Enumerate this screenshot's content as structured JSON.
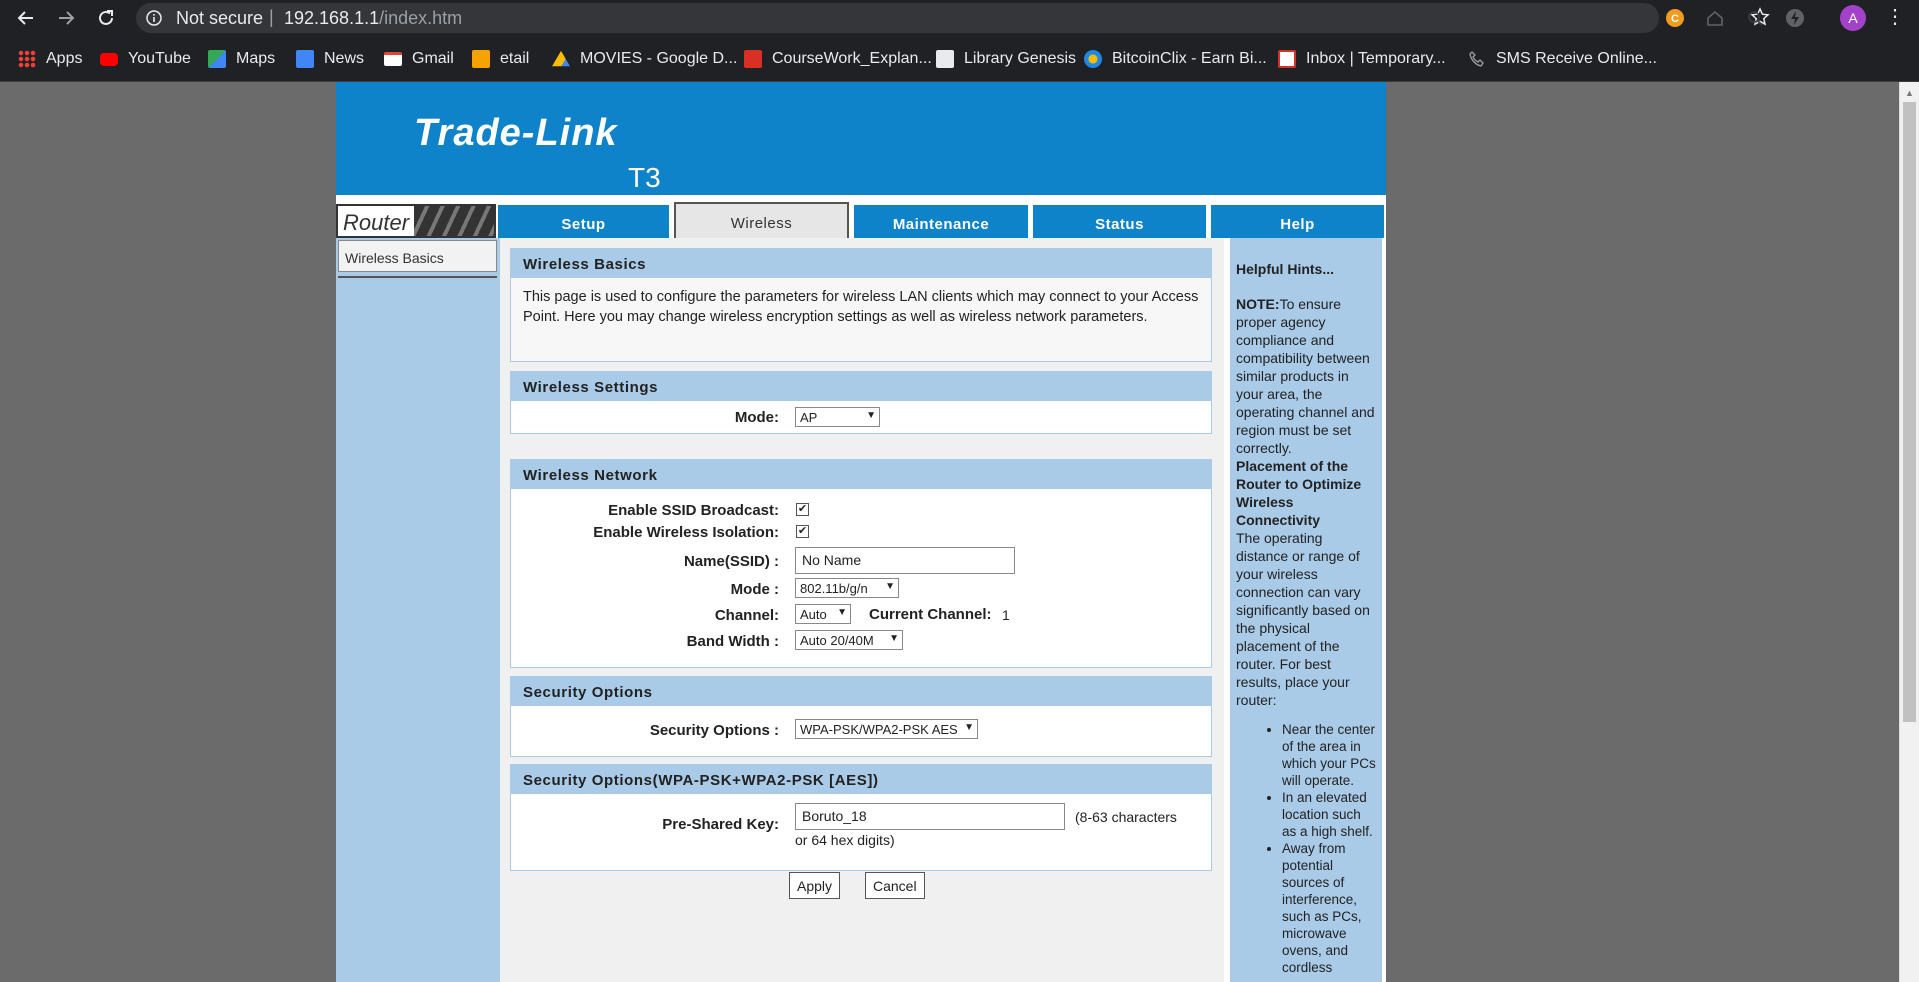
{
  "browser": {
    "security_label": "Not secure",
    "url_host": "192.168.1.1",
    "url_path": "/index.htm",
    "avatar_letter": "A"
  },
  "bookmarks": [
    {
      "label": "Apps",
      "icon": "apps-grid-icon",
      "color": "#4285f4"
    },
    {
      "label": "YouTube",
      "icon": "youtube-icon",
      "color": "#ff0000"
    },
    {
      "label": "Maps",
      "icon": "maps-icon",
      "color": "#34a853"
    },
    {
      "label": "News",
      "icon": "news-icon",
      "color": "#4285f4"
    },
    {
      "label": "Gmail",
      "icon": "gmail-icon",
      "color": "#ea4335"
    },
    {
      "label": "etail",
      "icon": "etail-icon",
      "color": "#f4a300"
    },
    {
      "label": "MOVIES - Google D...",
      "icon": "google-drive-icon",
      "color": "#fbbc04"
    },
    {
      "label": "CourseWork_Explan...",
      "icon": "coursework-icon",
      "color": "#d93025"
    },
    {
      "label": "Library Genesis",
      "icon": "library-icon",
      "color": "#e8eaed"
    },
    {
      "label": "BitcoinClix - Earn Bi...",
      "icon": "bitcoinclix-icon",
      "color": "#1e88e5"
    },
    {
      "label": "Inbox | Temporary...",
      "icon": "inbox-icon",
      "color": "#d93025"
    },
    {
      "label": "SMS Receive Online...",
      "icon": "phone-icon",
      "color": "#9aa0a6"
    }
  ],
  "router": {
    "brand": "Trade-Link",
    "model": "T3",
    "logo_text": "Router",
    "tabs": [
      "Setup",
      "Wireless",
      "Maintenance",
      "Status",
      "Help"
    ],
    "active_tab": "Wireless",
    "left_nav": [
      "Wireless Basics"
    ],
    "colors": {
      "brand_blue": "#0f83c9",
      "section_blue": "#a9cbe8"
    }
  },
  "basics": {
    "title": "Wireless Basics",
    "description": "This page is used to configure the parameters for wireless LAN clients which may connect to your Access Point. Here you may change wireless encryption settings as well as wireless network parameters."
  },
  "settings": {
    "title": "Wireless Settings",
    "mode_label": "Mode:",
    "mode_value": "AP"
  },
  "network": {
    "title": "Wireless Network",
    "ssid_broadcast_label": "Enable SSID Broadcast:",
    "ssid_broadcast_checked": true,
    "isolation_label": "Enable Wireless Isolation:",
    "isolation_checked": true,
    "name_label": "Name(SSID) :",
    "name_value": "No Name",
    "mode_label": "Mode :",
    "mode_value": "802.11b/g/n",
    "channel_label": "Channel:",
    "channel_value": "Auto",
    "current_channel_label": "Current Channel:",
    "current_channel_value": "1",
    "bandwidth_label": "Band Width :",
    "bandwidth_value": "Auto 20/40M"
  },
  "security": {
    "title": "Security Options",
    "label": "Security Options :",
    "value": "WPA-PSK/WPA2-PSK AES"
  },
  "wpa": {
    "title": "Security Options(WPA-PSK+WPA2-PSK [AES])",
    "psk_label": "Pre-Shared Key:",
    "psk_value": "Boruto_18",
    "psk_hint_1": "(8-63 characters",
    "psk_hint_2": "or 64 hex digits)"
  },
  "buttons": {
    "apply": "Apply",
    "cancel": "Cancel"
  },
  "hints": {
    "title": "Helpful Hints...",
    "note_label": "NOTE:",
    "note_text": "To ensure proper agency compliance and compatibility between similar products in your area, the operating channel and region must be set correctly.",
    "placement_title": "Placement of the Router to Optimize Wireless Connectivity",
    "placement_text": "The operating distance or range of your wireless connection can vary significantly based on the physical placement of the router. For best results, place your router:",
    "bullets": [
      "Near the center of the area in which your PCs will operate.",
      "In an elevated location such as a high shelf.",
      "Away from potential sources of interference, such as PCs, microwave ovens, and cordless"
    ]
  }
}
